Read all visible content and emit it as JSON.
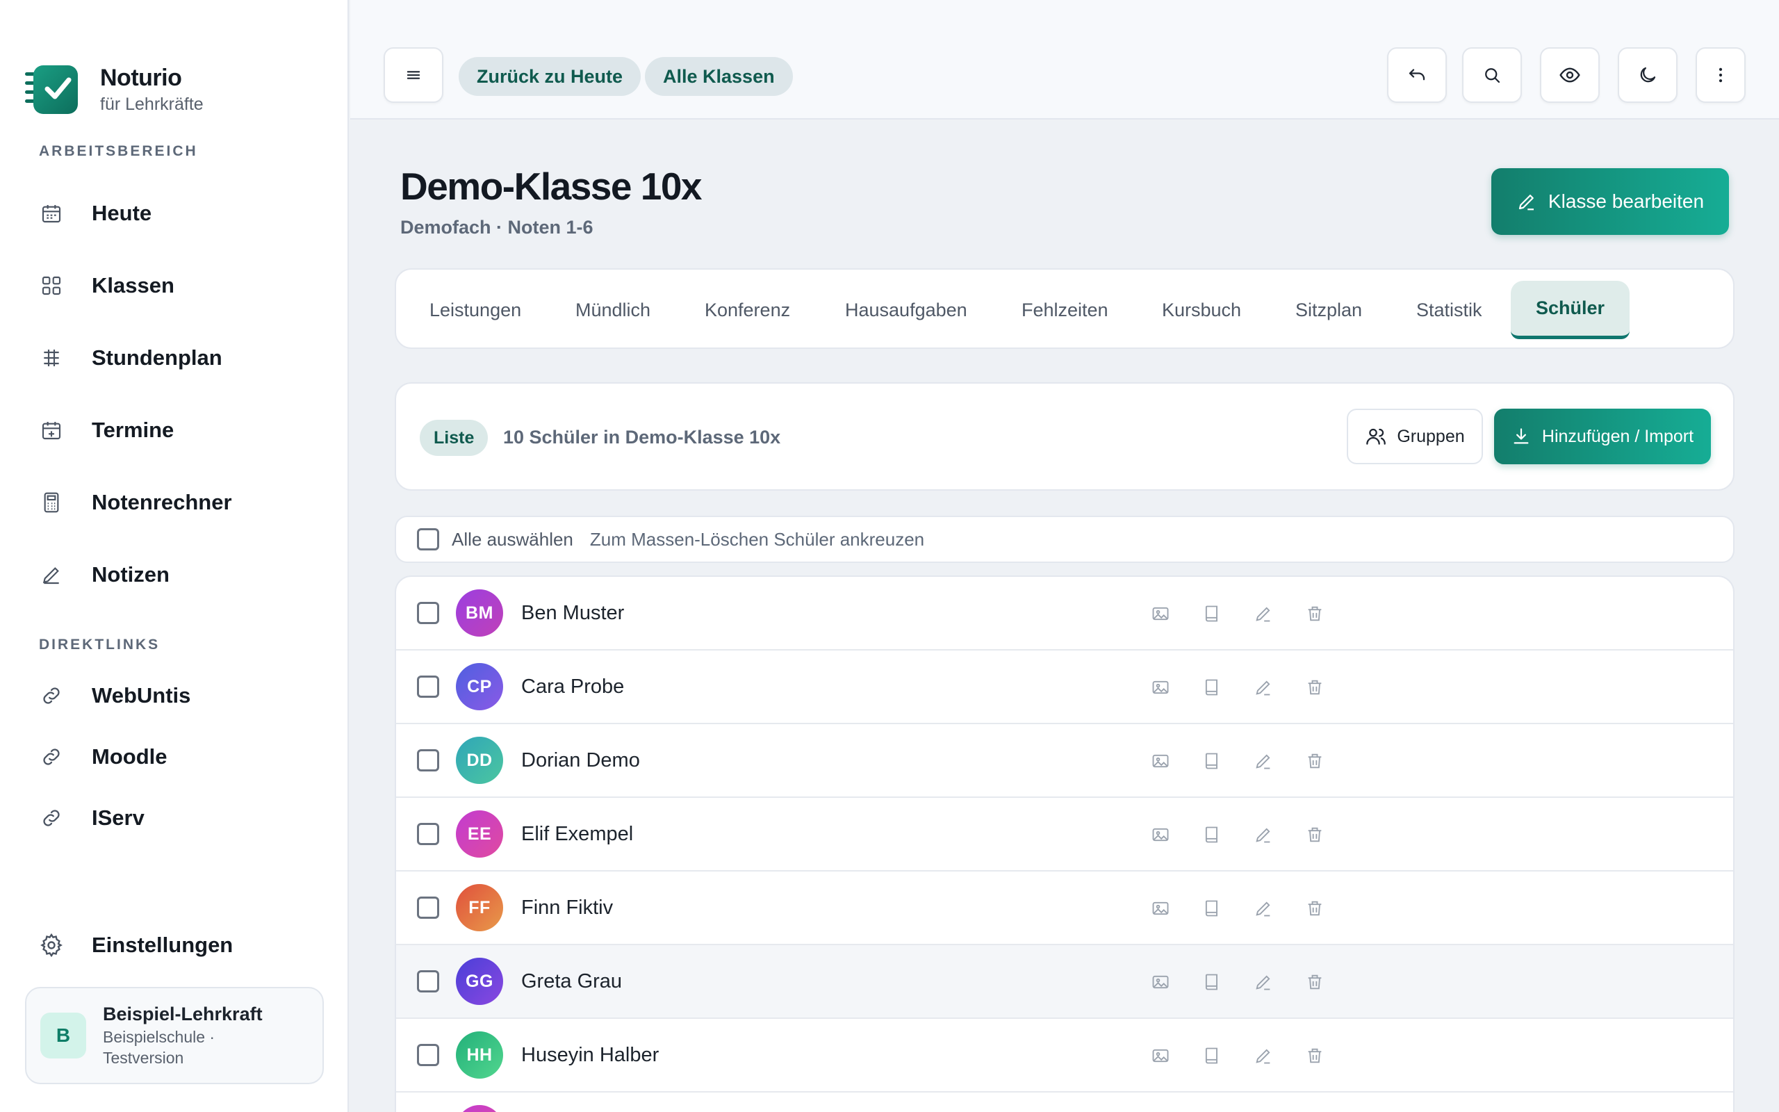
{
  "brand": {
    "name": "Noturio",
    "subtitle": "für Lehrkräfte"
  },
  "sidebar": {
    "section_workspace": "ARBEITSBEREICH",
    "items": [
      {
        "label": "Heute",
        "icon": "calendar-icon"
      },
      {
        "label": "Klassen",
        "icon": "grid-icon"
      },
      {
        "label": "Stundenplan",
        "icon": "timetable-icon"
      },
      {
        "label": "Termine",
        "icon": "calendar-plus-icon"
      },
      {
        "label": "Notenrechner",
        "icon": "calculator-icon"
      },
      {
        "label": "Notizen",
        "icon": "pencil-icon"
      }
    ],
    "section_links": "DIREKTLINKS",
    "links": [
      {
        "label": "WebUntis",
        "icon": "link-icon"
      },
      {
        "label": "Moodle",
        "icon": "link-icon"
      },
      {
        "label": "IServ",
        "icon": "link-icon"
      }
    ],
    "settings_label": "Einstellungen",
    "user": {
      "initial": "B",
      "name": "Beispiel-Lehrkraft",
      "meta": "Beispielschule · Testversion"
    }
  },
  "topbar": {
    "pill_today": "Zurück zu Heute",
    "pill_classes": "Alle Klassen",
    "icons": [
      "menu-icon",
      "undo-icon",
      "search-icon",
      "eye-icon",
      "moon-icon",
      "more-vertical-icon"
    ]
  },
  "page": {
    "title": "Demo-Klasse 10x",
    "subtitle": "Demofach · Noten 1-6",
    "edit_button": "Klasse bearbeiten"
  },
  "tabs": [
    {
      "label": "Leistungen"
    },
    {
      "label": "Mündlich"
    },
    {
      "label": "Konferenz"
    },
    {
      "label": "Hausaufgaben"
    },
    {
      "label": "Fehlzeiten"
    },
    {
      "label": "Kursbuch"
    },
    {
      "label": "Sitzplan"
    },
    {
      "label": "Statistik"
    },
    {
      "label": "Schüler",
      "active": true
    }
  ],
  "list": {
    "badge": "Liste",
    "count_text": "10 Schüler in Demo-Klasse 10x",
    "groups_button": "Gruppen",
    "import_button": "Hinzufügen / Import",
    "select_all": "Alle auswählen",
    "select_hint": "Zum Massen-Löschen Schüler ankreuzen"
  },
  "students": [
    {
      "initials": "BM",
      "name": "Ben Muster",
      "color_from": "#9b3fe0",
      "color_to": "#c040b8"
    },
    {
      "initials": "CP",
      "name": "Cara Probe",
      "color_from": "#4f5fe0",
      "color_to": "#8a5ae6"
    },
    {
      "initials": "DD",
      "name": "Dorian Demo",
      "color_from": "#2fa6b8",
      "color_to": "#4cc6a0"
    },
    {
      "initials": "EE",
      "name": "Elif Exempel",
      "color_from": "#c23cd0",
      "color_to": "#e04aa0"
    },
    {
      "initials": "FF",
      "name": "Finn Fiktiv",
      "color_from": "#e0503c",
      "color_to": "#e89a4a"
    },
    {
      "initials": "GG",
      "name": "Greta Grau",
      "color_from": "#4a3fd8",
      "color_to": "#8a48e0"
    },
    {
      "initials": "HH",
      "name": "Huseyin Halber",
      "color_from": "#22b07a",
      "color_to": "#52d68e"
    },
    {
      "initials": "",
      "name": "",
      "color_from": "#c23cd0",
      "color_to": "#e04aa0"
    }
  ]
}
